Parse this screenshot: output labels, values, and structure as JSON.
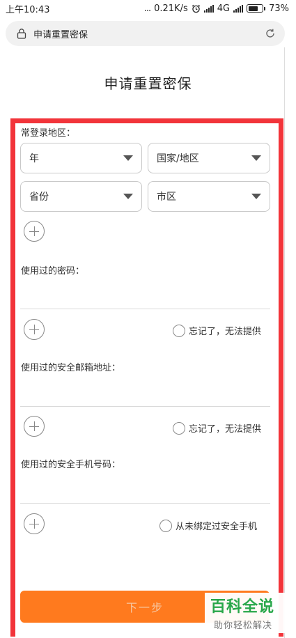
{
  "status_bar": {
    "time": "上午10:43",
    "dots": "...",
    "network_speed": "0.21K/s",
    "network_type": "4G",
    "battery": "73%"
  },
  "browser": {
    "url": "申请重置密保"
  },
  "page": {
    "title": "申请重置密保"
  },
  "form": {
    "region_label": "常登录地区：",
    "year_select": "年",
    "country_select": "国家/地区",
    "province_select": "省份",
    "city_select": "市区",
    "password_label": "使用过的密码：",
    "password_forgot": "忘记了，无法提供",
    "email_label": "使用过的安全邮箱地址：",
    "email_forgot": "忘记了，无法提供",
    "phone_label": "使用过的安全手机号码：",
    "phone_never_bound": "从未绑定过安全手机",
    "next_button": "下一步"
  },
  "watermark": {
    "title": "百科全说",
    "subtitle": "助你轻松解决"
  },
  "colors": {
    "highlight_frame": "#f2343a",
    "next_button": "#ff7a1e",
    "watermark_green": "#28a74a"
  }
}
